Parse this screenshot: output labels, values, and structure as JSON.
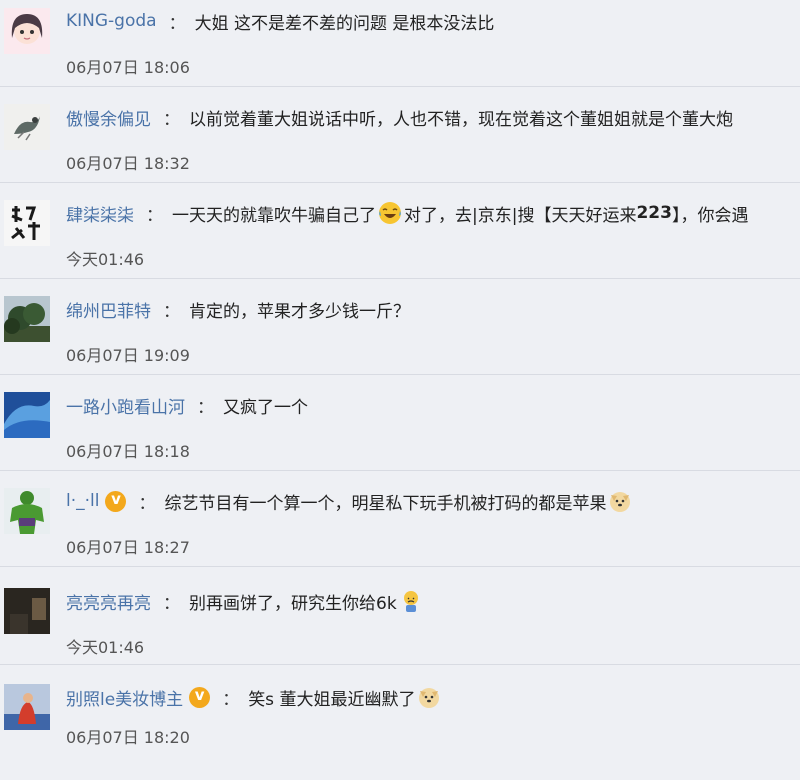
{
  "comments": [
    {
      "user": "KING-goda",
      "text": "大姐 这不是差不差的问题 是根本没法比",
      "time": "06月07日 18:06",
      "avatar": "girl-avatar"
    },
    {
      "user": "傲慢余偏见",
      "text": "以前觉着董大姐说话中听，人也不错，现在觉着这个董姐姐就是个董大炮",
      "time": "06月07日 18:32",
      "avatar": "bird-ink-avatar"
    },
    {
      "user": "肆柒柒柒",
      "text_a": "一天天的就靠吹牛骗自己了",
      "text_b": "对了，去|京东|搜【天天好运来",
      "text_bold": "223",
      "text_c": "】，你会遇",
      "time": "今天01:46",
      "avatar": "calligraphy-avatar",
      "emoji": "laughing-tears-emoji"
    },
    {
      "user": "绵州巴菲特",
      "text": "肯定的，苹果才多少钱一斤？",
      "time": "06月07日 19:09",
      "avatar": "tree-landscape-avatar"
    },
    {
      "user": "一路小跑看山河",
      "text": "又疯了一个",
      "time": "06月07日 18:18",
      "avatar": "blue-wave-avatar"
    },
    {
      "user": "l·_·ll",
      "text": "综艺节目有一个算一个，明星私下玩手机被打码的都是苹果",
      "time": "06月07日 18:27",
      "avatar": "hulk-avatar",
      "verified": true,
      "emoji": "doge-emoji"
    },
    {
      "user": "亮亮亮再亮",
      "text": "别再画饼了，研究生你给6k",
      "time": "今天01:46",
      "avatar": "dark-room-avatar",
      "emoji": "sad-emoji"
    },
    {
      "user": "别照le美妆博主",
      "text": "笑s 董大姐最近幽默了",
      "time": "06月07日 18:20",
      "avatar": "red-figure-avatar",
      "verified": true,
      "emoji": "doge-emoji"
    }
  ],
  "colors": {
    "username": "#4a73a8",
    "background": "#eef0f4",
    "verified": "#f3a81c"
  }
}
